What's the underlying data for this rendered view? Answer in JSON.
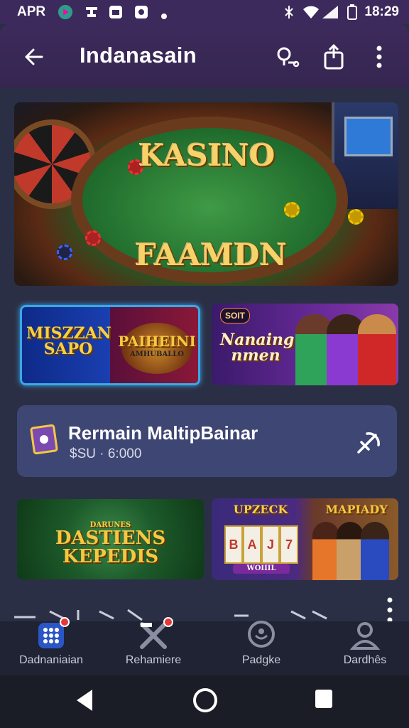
{
  "status_bar": {
    "carrier": "APR",
    "time": "18:29"
  },
  "app_bar": {
    "back_icon": "arrow-left-icon",
    "title": "Indanasain",
    "action_icons": [
      "key-icon",
      "share-icon",
      "more-vert-icon"
    ]
  },
  "hero": {
    "line1": "KASINO",
    "line2": "FAAMDN"
  },
  "cards_row1": [
    {
      "left_text": "MISZZAN SAPO",
      "right_text": "PAIHEINI",
      "right_sub": "AMHUBALLO"
    },
    {
      "badge": "SOIT",
      "text": "Nanaing nmen"
    }
  ],
  "promo": {
    "title": "Rermain MaltipBainar",
    "subtitle": "$SU · 6:000"
  },
  "cards_row2": [
    {
      "text": "DASTIENS KEPEDIS",
      "small": "DARUNES"
    },
    {
      "slot_title": "UPZECK",
      "reels": [
        "B",
        "A",
        "J",
        "7"
      ],
      "slot_bar": "WOIIIL",
      "right_title": "MAPIADY"
    }
  ],
  "bottom_nav": [
    {
      "label": "Dadnaniaian",
      "icon": "grid-icon",
      "active": true,
      "badge": true
    },
    {
      "label": "Rehamiere",
      "icon": "x-icon",
      "active": false,
      "badge": true
    },
    {
      "label": "Padgke",
      "icon": "chat-icon",
      "active": false,
      "badge": false
    },
    {
      "label": "Dardhês",
      "icon": "person-icon",
      "active": false,
      "badge": false
    }
  ],
  "colors": {
    "background": "#2b2f45",
    "app_bar": "#3d2a5c",
    "promo_card": "#3e4674",
    "nav_bar": "#1f2334",
    "accent_blue": "#3aa7e6",
    "gold": "#f5c842"
  }
}
